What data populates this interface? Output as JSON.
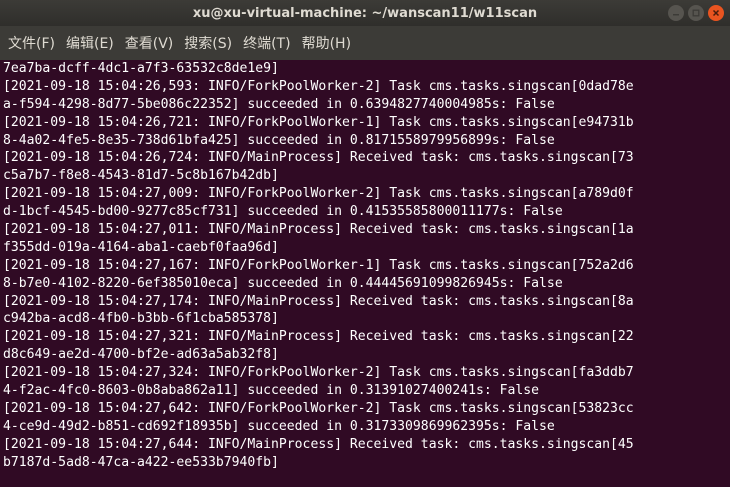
{
  "window": {
    "title": "xu@xu-virtual-machine: ~/wanscan11/w11scan",
    "controls": {
      "minimize_icon": "minimize-icon",
      "maximize_icon": "maximize-icon",
      "close_icon": "close-icon"
    }
  },
  "menu": [
    {
      "label": "文件(F)"
    },
    {
      "label": "编辑(E)"
    },
    {
      "label": "查看(V)"
    },
    {
      "label": "搜索(S)"
    },
    {
      "label": "终端(T)"
    },
    {
      "label": "帮助(H)"
    }
  ],
  "terminal": {
    "lines": [
      "7ea7ba-dcff-4dc1-a7f3-63532c8de1e9]",
      "[2021-09-18 15:04:26,593: INFO/ForkPoolWorker-2] Task cms.tasks.singscan[0dad78e",
      "a-f594-4298-8d77-5be086c22352] succeeded in 0.6394827740004985s: False",
      "[2021-09-18 15:04:26,721: INFO/ForkPoolWorker-1] Task cms.tasks.singscan[e94731b",
      "8-4a02-4fe5-8e35-738d61bfa425] succeeded in 0.8171558979956899s: False",
      "[2021-09-18 15:04:26,724: INFO/MainProcess] Received task: cms.tasks.singscan[73",
      "c5a7b7-f8e8-4543-81d7-5c8b167b42db]",
      "[2021-09-18 15:04:27,009: INFO/ForkPoolWorker-2] Task cms.tasks.singscan[a789d0f",
      "d-1bcf-4545-bd00-9277c85cf731] succeeded in 0.41535585800011177s: False",
      "[2021-09-18 15:04:27,011: INFO/MainProcess] Received task: cms.tasks.singscan[1a",
      "f355dd-019a-4164-aba1-caebf0faa96d]",
      "[2021-09-18 15:04:27,167: INFO/ForkPoolWorker-1] Task cms.tasks.singscan[752a2d6",
      "8-b7e0-4102-8220-6ef385010eca] succeeded in 0.44445691099826945s: False",
      "[2021-09-18 15:04:27,174: INFO/MainProcess] Received task: cms.tasks.singscan[8a",
      "c942ba-acd8-4fb0-b3bb-6f1cba585378]",
      "[2021-09-18 15:04:27,321: INFO/MainProcess] Received task: cms.tasks.singscan[22",
      "d8c649-ae2d-4700-bf2e-ad63a5ab32f8]",
      "[2021-09-18 15:04:27,324: INFO/ForkPoolWorker-2] Task cms.tasks.singscan[fa3ddb7",
      "4-f2ac-4fc0-8603-0b8aba862a11] succeeded in 0.31391027400241s: False",
      "[2021-09-18 15:04:27,642: INFO/ForkPoolWorker-2] Task cms.tasks.singscan[53823cc",
      "4-ce9d-49d2-b851-cd692f18935b] succeeded in 0.3173309869962395s: False",
      "[2021-09-18 15:04:27,644: INFO/MainProcess] Received task: cms.tasks.singscan[45",
      "b7187d-5ad8-47ca-a422-ee533b7940fb]"
    ]
  },
  "colors": {
    "terminal_background": "#300a24",
    "terminal_text": "#ffffff",
    "titlebar": "#3c3b37",
    "close_button": "#e95420"
  }
}
